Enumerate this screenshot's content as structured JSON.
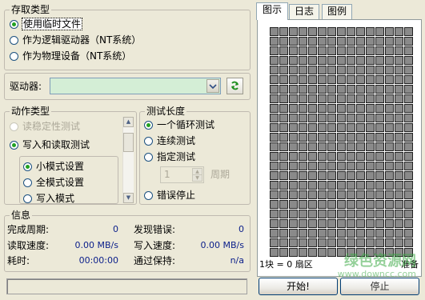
{
  "storage": {
    "title": "存取类型",
    "options": [
      {
        "label": "使用临时文件",
        "selected": true
      },
      {
        "label": "作为逻辑驱动器（NT系统）",
        "selected": false
      },
      {
        "label": "作为物理设备（NT系统）",
        "selected": false
      }
    ]
  },
  "drive": {
    "label": "驱动器:",
    "value": "",
    "refresh_icon": "refresh-icon",
    "refresh_color": "#1E8E1E"
  },
  "action": {
    "title": "动作类型",
    "options": [
      {
        "label": "读稳定性测试",
        "selected": false,
        "disabled": true
      },
      {
        "label": "写入和读取测试",
        "selected": true,
        "disabled": false
      }
    ],
    "mode": {
      "options": [
        {
          "label": "小模式设置",
          "selected": true
        },
        {
          "label": "全模式设置",
          "selected": false
        },
        {
          "label": "写入模式",
          "selected": false
        }
      ]
    }
  },
  "test_length": {
    "title": "测试长度",
    "options": [
      {
        "label": "一个循环测试",
        "selected": true
      },
      {
        "label": "连续测试",
        "selected": false
      },
      {
        "label": "指定测试",
        "selected": false
      }
    ],
    "cycles_value": "1",
    "cycles_unit": "周期",
    "stop_on_error": {
      "label": "错误停止",
      "selected": false
    }
  },
  "info": {
    "title": "信息",
    "completed_label": "完成周期:",
    "completed_value": "0",
    "errors_label": "发现错误:",
    "errors_value": "0",
    "read_label": "读取速度:",
    "read_value": "0.00 MB/s",
    "write_label": "写入速度:",
    "write_value": "0.00 MB/s",
    "elapsed_label": "耗时:",
    "elapsed_value": "00:00:00",
    "pass_label": "通过保持:",
    "pass_value": "n/a"
  },
  "tabs": [
    {
      "label": "图示",
      "active": true
    },
    {
      "label": "日志",
      "active": false
    },
    {
      "label": "图例",
      "active": false
    }
  ],
  "status": {
    "block_info": "1块 = 0 扇区",
    "ready": "准备"
  },
  "buttons": {
    "start": "开始!",
    "stop": "停止"
  },
  "watermark": {
    "text": "绿色资源网",
    "url": "www.downcc.com"
  },
  "grid": {
    "columns": 15,
    "rows": 24,
    "cell_color": "#8A8A8A"
  }
}
